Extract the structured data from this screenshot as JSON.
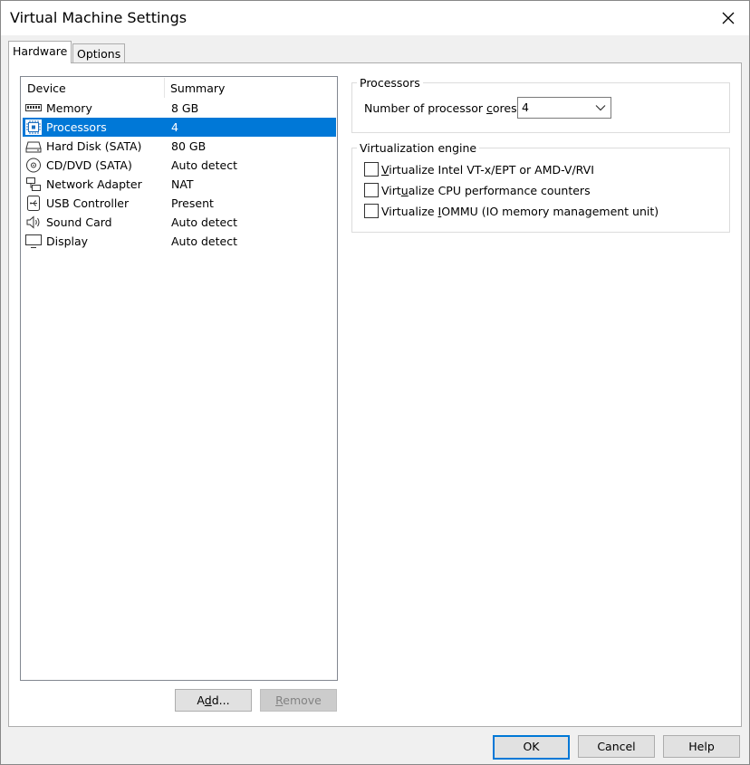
{
  "window": {
    "title": "Virtual Machine Settings"
  },
  "tabs": [
    {
      "label": "Hardware",
      "active": true
    },
    {
      "label": "Options",
      "active": false
    }
  ],
  "device_list": {
    "headers": {
      "device": "Device",
      "summary": "Summary"
    },
    "rows": [
      {
        "device": "Memory",
        "summary": "8 GB",
        "icon": "memory-icon"
      },
      {
        "device": "Processors",
        "summary": "4",
        "icon": "processor-icon",
        "selected": true
      },
      {
        "device": "Hard Disk (SATA)",
        "summary": "80 GB",
        "icon": "hard-disk-icon"
      },
      {
        "device": "CD/DVD (SATA)",
        "summary": "Auto detect",
        "icon": "cd-dvd-icon"
      },
      {
        "device": "Network Adapter",
        "summary": "NAT",
        "icon": "network-adapter-icon"
      },
      {
        "device": "USB Controller",
        "summary": "Present",
        "icon": "usb-icon"
      },
      {
        "device": "Sound Card",
        "summary": "Auto detect",
        "icon": "speaker-icon"
      },
      {
        "device": "Display",
        "summary": "Auto detect",
        "icon": "display-icon"
      }
    ]
  },
  "list_buttons": {
    "add_pre": "A",
    "add_u": "d",
    "add_post": "d...",
    "remove_pre": "",
    "remove_u": "R",
    "remove_post": "emove"
  },
  "processors_group": {
    "legend": "Processors",
    "cores_label_pre": "Number of processor ",
    "cores_label_u": "c",
    "cores_label_post": "ores:",
    "cores_value": "4"
  },
  "virtualization_group": {
    "legend": "Virtualization engine",
    "options": [
      {
        "pre": "",
        "u": "V",
        "post": "irtualize Intel VT-x/EPT or AMD-V/RVI",
        "checked": false
      },
      {
        "pre": "Virt",
        "u": "u",
        "post": "alize CPU performance counters",
        "checked": false
      },
      {
        "pre": "Virtualize ",
        "u": "I",
        "post": "OMMU (IO memory management unit)",
        "checked": false
      }
    ]
  },
  "footer_buttons": {
    "ok": "OK",
    "cancel": "Cancel",
    "help": "Help"
  },
  "colors": {
    "selection": "#0078d7",
    "window_bg": "#f0f0f0",
    "panel_bg": "#ffffff"
  }
}
